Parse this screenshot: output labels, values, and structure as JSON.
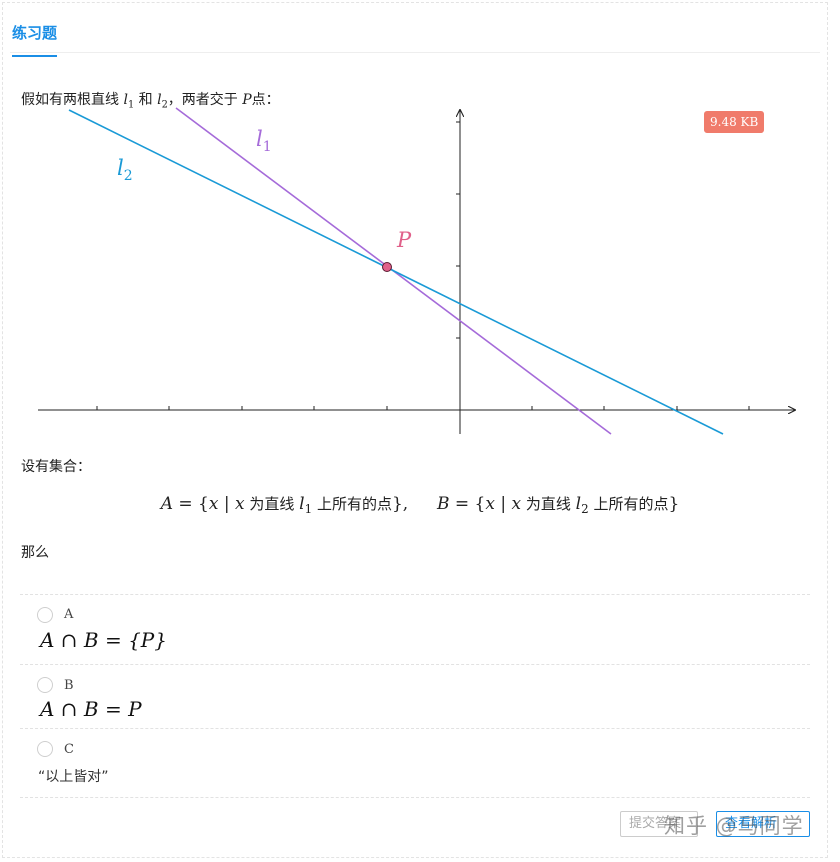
{
  "tab": {
    "label": "练习题"
  },
  "intro": {
    "prefix": "假如有两根直线",
    "l": "l",
    "one": "1",
    "two": "2",
    "and": "和",
    "suffix1": "，两者交于",
    "P": "P",
    "suffix2": "点："
  },
  "file_badge": "9.48 KB",
  "graph": {
    "l1_label": "l",
    "l1_sub": "1",
    "l2_label": "l",
    "l2_sub": "2",
    "point_label": "P",
    "colors": {
      "l1": "#a56bd9",
      "l2": "#1a9ad6",
      "point": "#e0608a",
      "axis": "#222222"
    }
  },
  "sets_intro": "设有集合：",
  "sets": {
    "A": "A",
    "B": "B",
    "eq": " = {",
    "x": "x",
    "bar": " | ",
    "x2": "x",
    "on_line": " 为直线 ",
    "l": "l",
    "one": "1",
    "two": "2",
    "all_points": " 上所有的点",
    "close": "},"
  },
  "then": "那么",
  "options": [
    {
      "letter": "A",
      "formula": "A ∩ B = {P}"
    },
    {
      "letter": "B",
      "formula": "A ∩ B = P"
    },
    {
      "letter": "C",
      "text": "“以上皆对”"
    }
  ],
  "buttons": {
    "submit": "提交答案",
    "view": "查看解析"
  },
  "watermark": "知乎 @马同学"
}
